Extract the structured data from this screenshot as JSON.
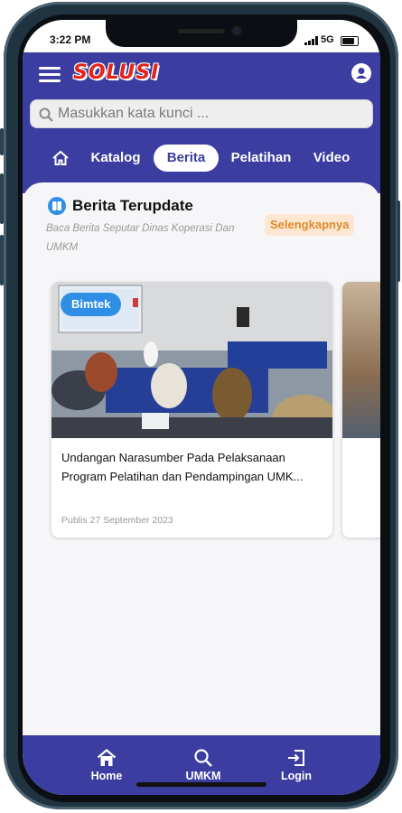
{
  "status_bar": {
    "time": "3:22 PM",
    "network": "5G"
  },
  "header": {
    "logo_text": "SOLUSI",
    "search": {
      "placeholder": "Masukkan kata kunci ...",
      "value": ""
    },
    "tabs": [
      {
        "icon": "home-icon"
      },
      {
        "label": "Katalog"
      },
      {
        "label": "Berita",
        "active": true
      },
      {
        "label": "Pelatihan"
      },
      {
        "label": "Video"
      }
    ]
  },
  "section": {
    "icon": "book-icon",
    "title": "Berita Terupdate",
    "subtitle": "Baca Berita Seputar Dinas Koperasi Dan UMKM",
    "more_label": "Selengkapnya"
  },
  "cards": [
    {
      "badge": "Bimtek",
      "title": "Undangan Narasumber Pada Pelaksanaan Program Pelatihan dan Pendampingan UMK...",
      "date": "Publis 27 September 2023"
    }
  ],
  "bottom_nav": [
    {
      "label": "Home",
      "icon": "home-icon"
    },
    {
      "label": "UMKM",
      "icon": "search-icon"
    },
    {
      "label": "Login",
      "icon": "login-icon"
    }
  ],
  "colors": {
    "primary": "#3b3ea0",
    "accent": "#2f8fe6",
    "orange": "#e08a2a",
    "logo_red": "#e1251b"
  }
}
